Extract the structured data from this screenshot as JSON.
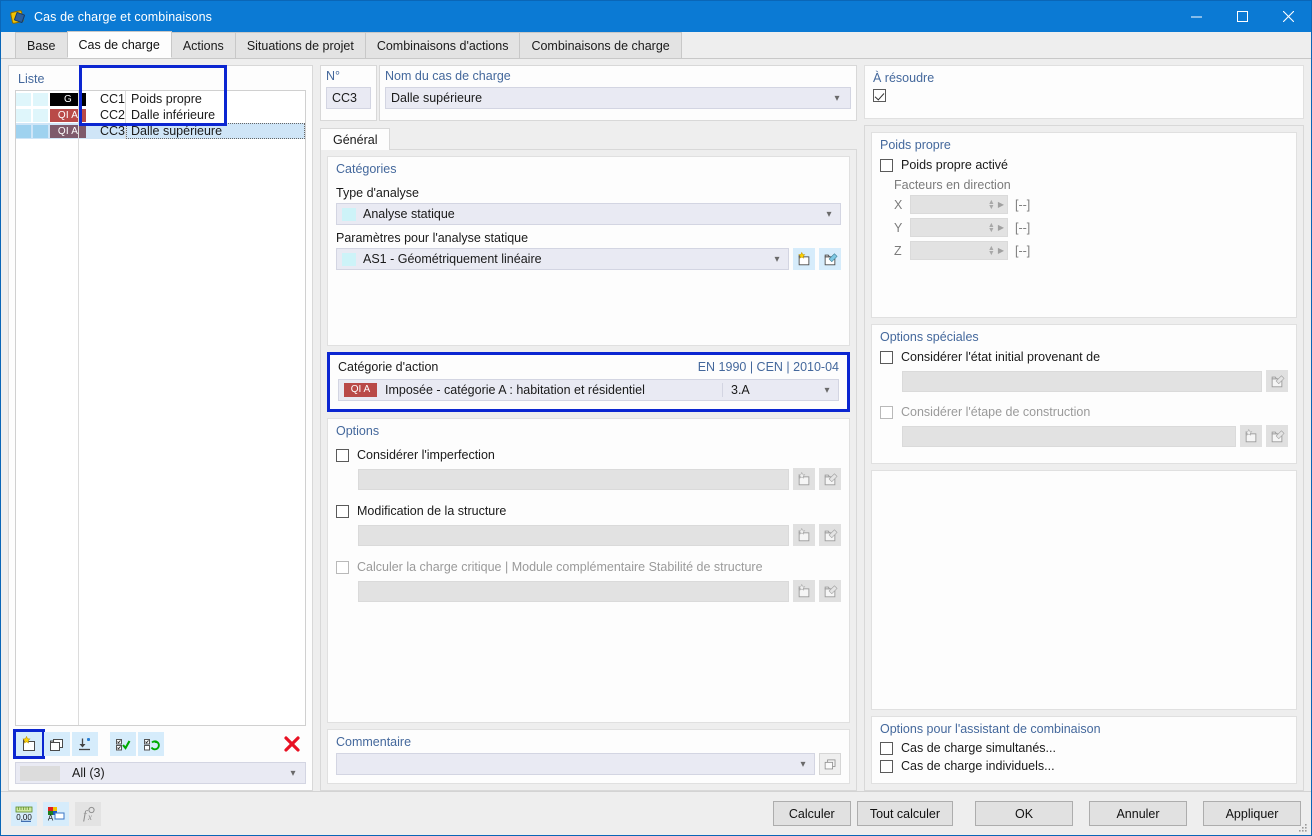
{
  "window": {
    "title": "Cas de charge et combinaisons",
    "icon": "app-icon",
    "minimize": "—",
    "maximize": "□",
    "close": "✕"
  },
  "tabs": [
    {
      "label": "Base",
      "active": false
    },
    {
      "label": "Cas de charge",
      "active": true
    },
    {
      "label": "Actions",
      "active": false
    },
    {
      "label": "Situations de projet",
      "active": false
    },
    {
      "label": "Combinaisons d'actions",
      "active": false
    },
    {
      "label": "Combinaisons de charge",
      "active": false
    }
  ],
  "list_panel": {
    "title": "Liste",
    "rows": [
      {
        "badge": "G",
        "badge_type": "g",
        "code": "CC1",
        "name": "Poids propre",
        "selected": false
      },
      {
        "badge": "QI A",
        "badge_type": "q",
        "code": "CC2",
        "name": "Dalle inférieure",
        "selected": false
      },
      {
        "badge": "QI A",
        "badge_type": "q",
        "code": "CC3",
        "name": "Dalle supérieure",
        "selected": true
      }
    ],
    "toolbar": [
      {
        "name": "new-load-case-button",
        "highlighted": true
      },
      {
        "name": "copy-load-case-button",
        "highlighted": false
      },
      {
        "name": "import-load-case-button",
        "highlighted": false
      },
      {
        "name": "select-all-button",
        "highlighted": false
      },
      {
        "name": "invert-selection-button",
        "highlighted": false
      },
      {
        "name": "delete-load-case-button",
        "highlighted": false
      }
    ],
    "filter": {
      "value": "All (3)"
    }
  },
  "header": {
    "number_label": "N°",
    "number_value": "CC3",
    "name_label": "Nom du cas de charge",
    "name_value": "Dalle supérieure"
  },
  "inner_tab": {
    "label": "Général"
  },
  "categories": {
    "title": "Catégories",
    "analysis_type_label": "Type d'analyse",
    "analysis_type_value": "Analyse statique",
    "static_params_label": "Paramètres pour l'analyse statique",
    "static_params_value": "AS1 - Géométriquement linéaire"
  },
  "action_category": {
    "title": "Catégorie d'action",
    "standard": "EN 1990 | CEN | 2010-04",
    "badge": "QI A",
    "value": "Imposée - catégorie A : habitation et résidentiel",
    "code": "3.A"
  },
  "options": {
    "title": "Options",
    "items": [
      {
        "label": "Considérer l'imperfection",
        "checked": false,
        "disabled": false,
        "buttons": 2
      },
      {
        "label": "Modification de la structure",
        "checked": false,
        "disabled": false,
        "buttons": 2
      },
      {
        "label": "Calculer la charge critique | Module complémentaire Stabilité de structure",
        "checked": false,
        "disabled": true,
        "buttons": 2
      }
    ]
  },
  "comment": {
    "title": "Commentaire",
    "value": ""
  },
  "to_solve": {
    "title": "À résoudre",
    "checked": true
  },
  "self_weight": {
    "title": "Poids propre",
    "enable_label": "Poids propre activé",
    "enabled": false,
    "factors_label": "Facteurs en direction",
    "axes": [
      {
        "axis": "X",
        "value": "",
        "unit": "[--]"
      },
      {
        "axis": "Y",
        "value": "",
        "unit": "[--]"
      },
      {
        "axis": "Z",
        "value": "",
        "unit": "[--]"
      }
    ]
  },
  "special_options": {
    "title": "Options spéciales",
    "items": [
      {
        "label": "Considérer l'état initial provenant de",
        "checked": false,
        "disabled": false,
        "buttons": 1
      },
      {
        "label": "Considérer l'étape de construction",
        "checked": false,
        "disabled": true,
        "buttons": 2
      }
    ]
  },
  "combination_wizard": {
    "title": "Options pour l'assistant de combinaison",
    "items": [
      {
        "label": "Cas de charge simultanés...",
        "checked": false
      },
      {
        "label": "Cas de charge individuels...",
        "checked": false
      }
    ]
  },
  "statusbar": {
    "icons": [
      {
        "name": "units-icon",
        "label": "0,00",
        "disabled": false
      },
      {
        "name": "colors-icon",
        "label": "",
        "disabled": false
      },
      {
        "name": "formula-icon",
        "label": "",
        "disabled": true
      }
    ],
    "buttons": [
      {
        "name": "calculate-button",
        "label": "Calculer"
      },
      {
        "name": "calculate-all-button",
        "label": "Tout calculer"
      },
      {
        "name": "ok-button",
        "label": "OK"
      },
      {
        "name": "cancel-button",
        "label": "Annuler"
      },
      {
        "name": "apply-button",
        "label": "Appliquer"
      }
    ]
  },
  "colors": {
    "titlebar": "#0b7ad4",
    "highlight_border": "#0b26d1",
    "group_label": "#44689c",
    "badge_permanent": "#000000",
    "badge_variable": "#b94a48",
    "badge_variable_selected": "#7e5a6b",
    "selection": "#cfe5f7",
    "field": "#e9eaf3",
    "delete_icon": "#e81123"
  }
}
